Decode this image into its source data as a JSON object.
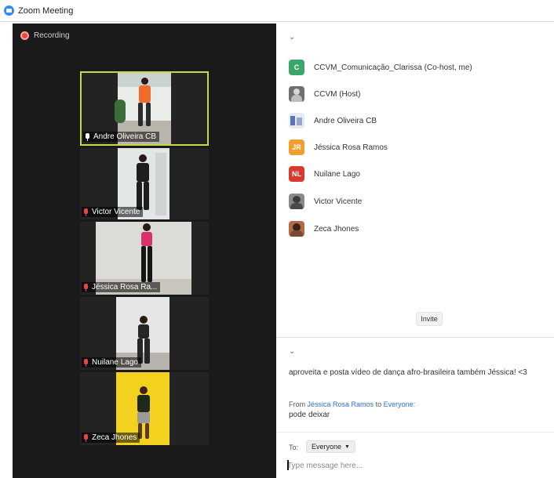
{
  "window": {
    "title": "Zoom Meeting",
    "logo_icon": "zoom-logo-icon"
  },
  "recording": {
    "label": "Recording",
    "icon": "record-dot-icon",
    "color": "#e8483f"
  },
  "video_tiles": [
    {
      "name": "Andre Oliveira CB",
      "mic": "unmuted",
      "active_speaker": true
    },
    {
      "name": "Victor Vicente",
      "mic": "muted",
      "active_speaker": false
    },
    {
      "name": "Jéssica Rosa Ra...",
      "mic": "muted",
      "active_speaker": false
    },
    {
      "name": "Nuilane Lago",
      "mic": "muted",
      "active_speaker": false
    },
    {
      "name": "Zeca Jhones",
      "mic": "muted",
      "active_speaker": false
    }
  ],
  "participants": {
    "collapse_icon": "chevron-down-icon",
    "list": [
      {
        "name": "CCVM_Comunicação_Clarissa (Co-host, me)",
        "avatar_type": "initials",
        "initials": "C",
        "color": "#3aa66a"
      },
      {
        "name": "CCVM (Host)",
        "avatar_type": "photo",
        "initials": "",
        "color": "#6f6f6f"
      },
      {
        "name": "Andre Oliveira CB",
        "avatar_type": "photo",
        "initials": "",
        "color": "#5a74b8"
      },
      {
        "name": "Jéssica Rosa Ramos",
        "avatar_type": "initials",
        "initials": "JR",
        "color": "#f0a030"
      },
      {
        "name": "Nuilane Lago",
        "avatar_type": "initials",
        "initials": "NL",
        "color": "#d93a2f"
      },
      {
        "name": "Victor Vicente",
        "avatar_type": "photo",
        "initials": "",
        "color": "#4b4b4b"
      },
      {
        "name": "Zeca Jhones",
        "avatar_type": "photo",
        "initials": "",
        "color": "#7a4a34"
      }
    ],
    "invite_label": "Invite"
  },
  "chat": {
    "collapse_icon": "chevron-down-icon",
    "messages": [
      {
        "text": "aproveita e posta vídeo de dança afro-brasileira também Jéssica! <3"
      },
      {
        "from_prefix": "From",
        "sender": "Jéssica Rosa Ramos",
        "to_word": "to",
        "target": "Everyone:",
        "text": "pode deixar"
      }
    ],
    "to_label": "To:",
    "recipient": "Everyone",
    "input_placeholder": "Type message here..."
  }
}
